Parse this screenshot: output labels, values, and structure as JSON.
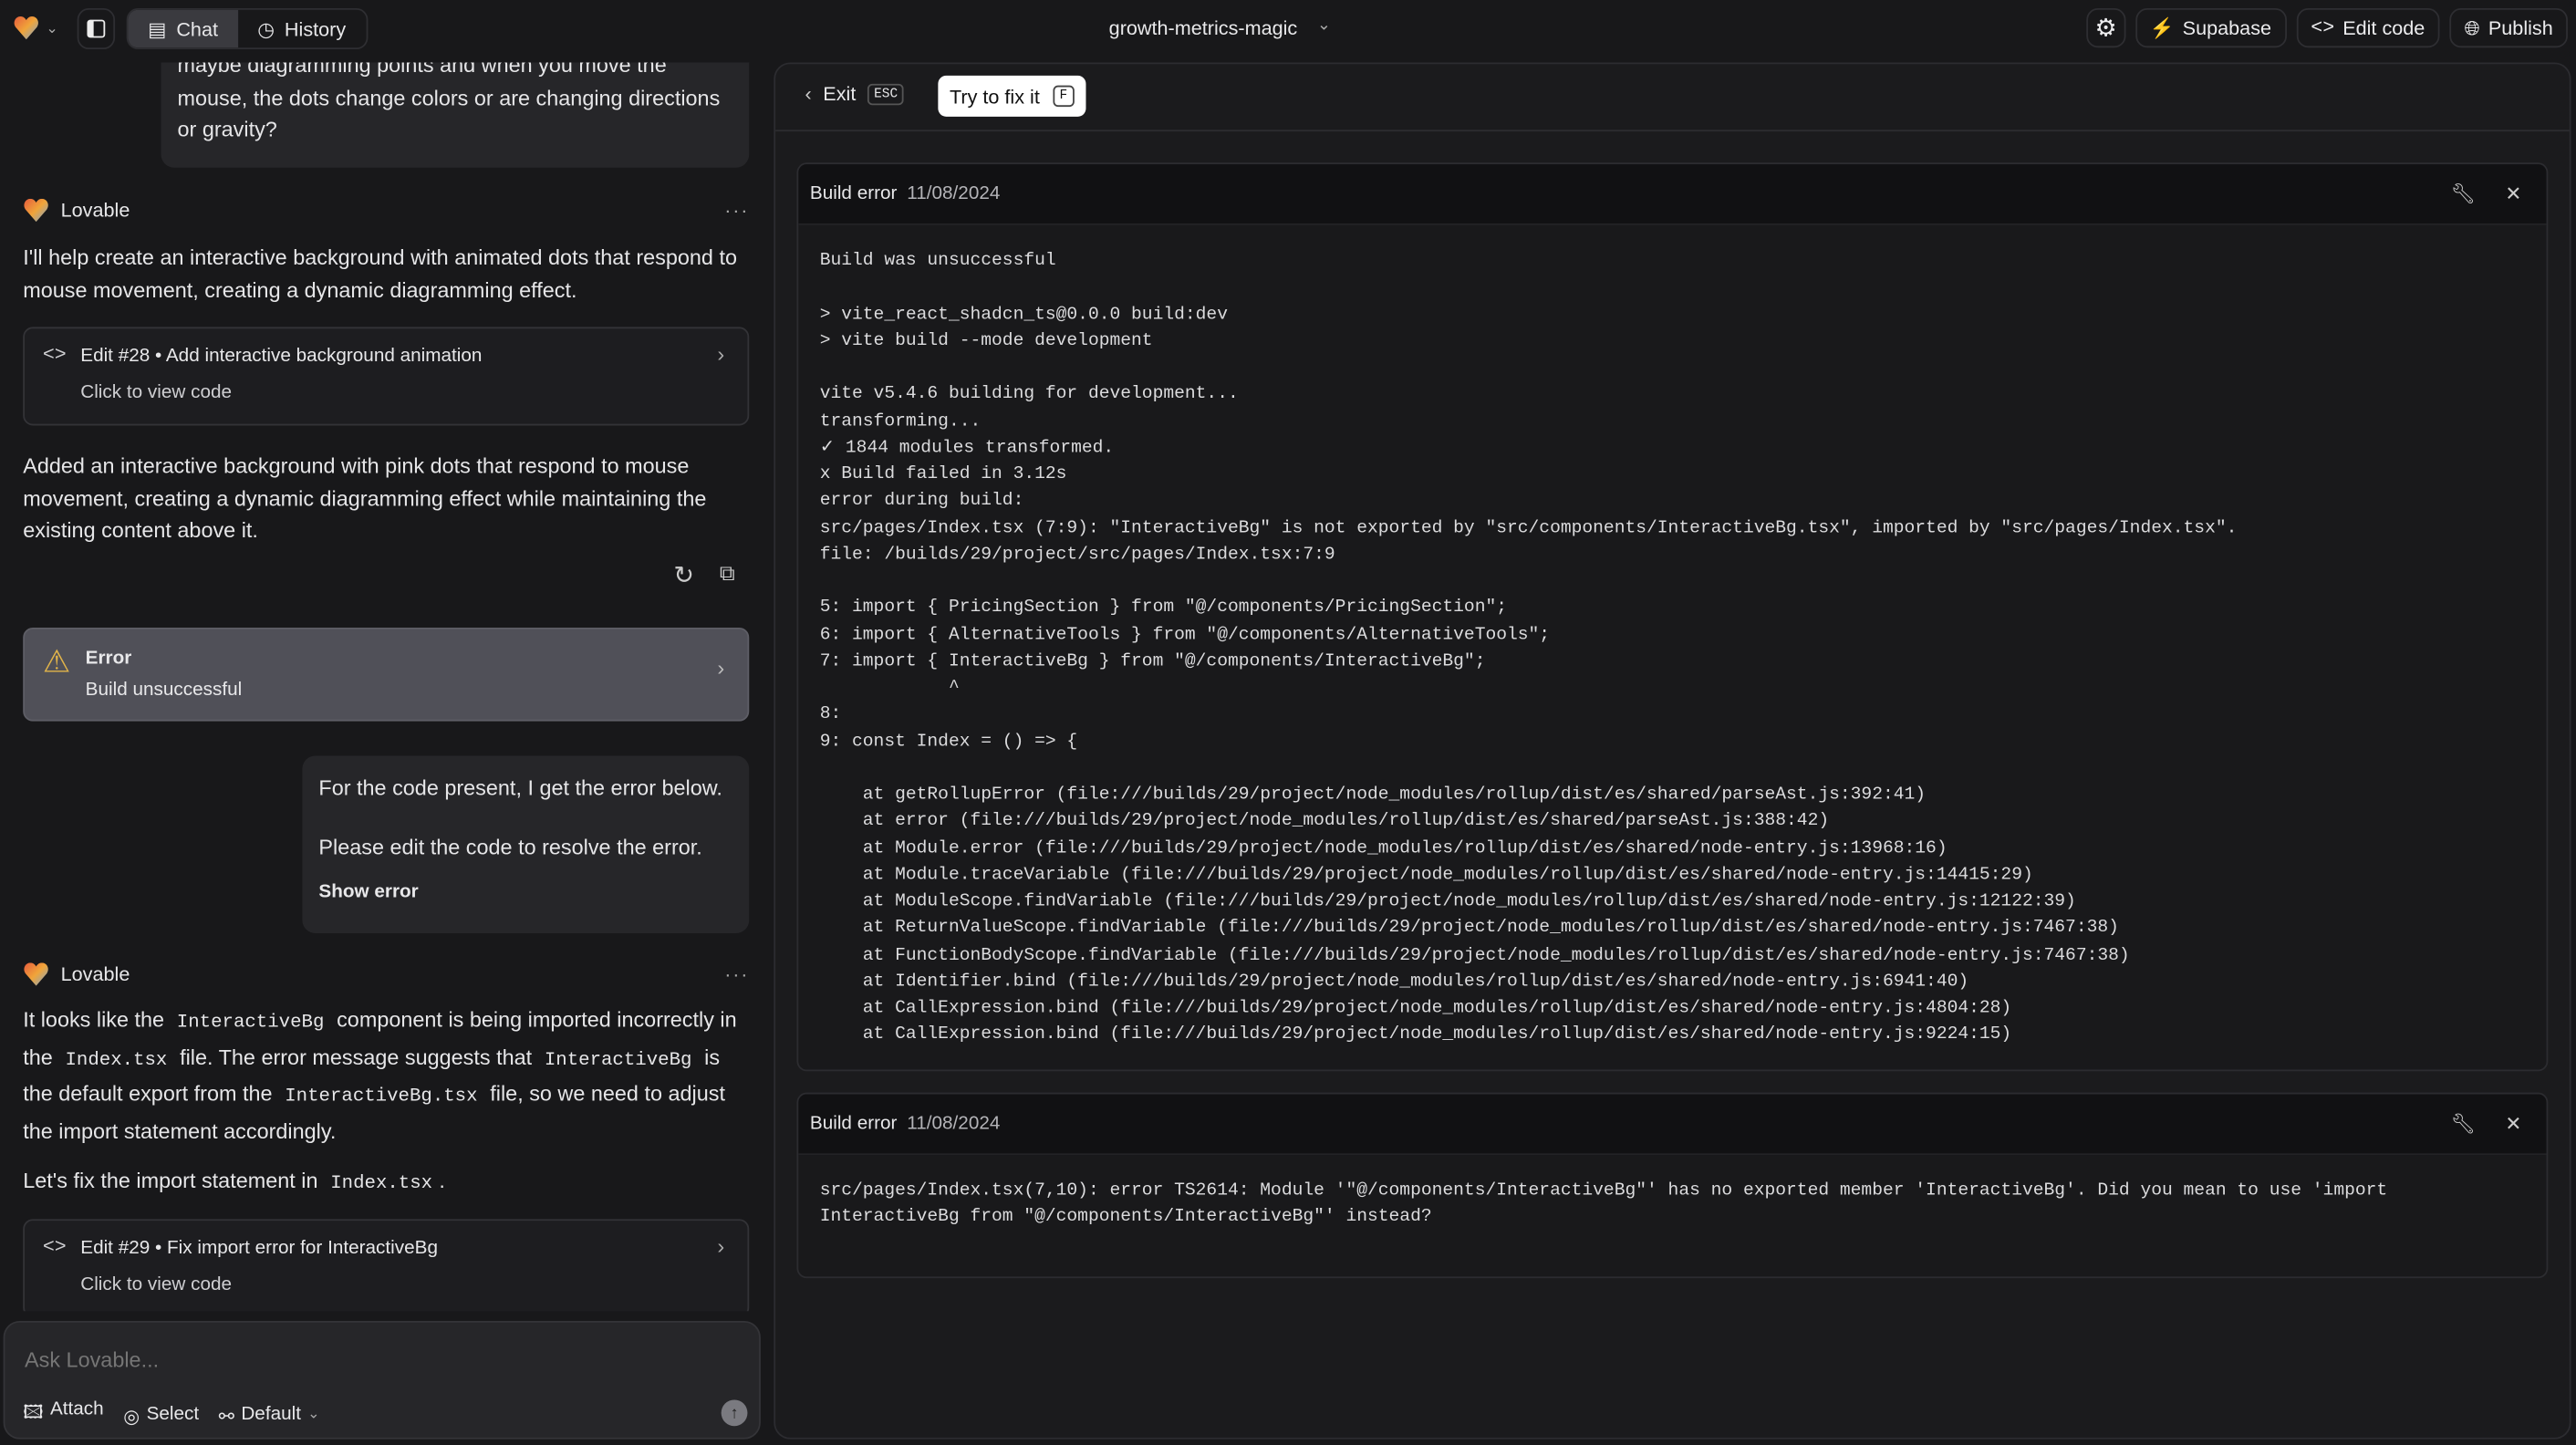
{
  "topbar": {
    "project_name": "growth-metrics-magic",
    "tabs": [
      {
        "label": "Chat",
        "active": true
      },
      {
        "label": "History"
      }
    ],
    "supabase": "Supabase",
    "edit_code": "Edit code",
    "publish": "Publish"
  },
  "chat": {
    "user_msg_1": "maybe diagramming points and when you move the mouse, the dots change colors or are changing directions or gravity?",
    "assistant_name": "Lovable",
    "reply_1": "I'll help create an interactive background with animated dots that respond to mouse movement, creating a dynamic diagramming effect.",
    "edit_1": {
      "title": "Edit #28 • Add interactive background animation",
      "subtitle": "Click to view code"
    },
    "reply_1b": "Added an interactive background with pink dots that respond to mouse movement, creating a dynamic diagramming effect while maintaining the existing content above it.",
    "error_card": {
      "title": "Error",
      "subtitle": "Build unsuccessful",
      "color": "#e0b34a"
    },
    "user_msg_2": {
      "line1": "For the code present, I get the error below.",
      "line2": "Please edit the code to resolve the error.",
      "show_error": "Show error"
    },
    "reply_2": [
      "It looks like the ",
      "InteractiveBg",
      " component is being imported incorrectly in the ",
      "Index.tsx",
      " file. The error message suggests that ",
      "InteractiveBg",
      " is the default export from the ",
      "InteractiveBg.tsx",
      " file, so we need to adjust the import statement accordingly."
    ],
    "reply_2b": [
      "Let's fix the import statement in ",
      "Index.tsx",
      "."
    ],
    "edit_2": {
      "title": "Edit #29 • Fix import error for InteractiveBg",
      "subtitle": "Click to view code"
    },
    "input": {
      "placeholder": "Ask Lovable...",
      "attach": "Attach",
      "select": "Select",
      "mode": "Default"
    }
  },
  "panel": {
    "exit": "Exit",
    "exit_key": "ESC",
    "try_fix": "Try to fix it",
    "try_fix_key": "F",
    "errors": [
      {
        "title": "Build error",
        "date": "11/08/2024",
        "log": "Build was unsuccessful\n\n> vite_react_shadcn_ts@0.0.0 build:dev\n> vite build --mode development\n\nvite v5.4.6 building for development...\ntransforming...\n✓ 1844 modules transformed.\nx Build failed in 3.12s\nerror during build:\nsrc/pages/Index.tsx (7:9): \"InteractiveBg\" is not exported by \"src/components/InteractiveBg.tsx\", imported by \"src/pages/Index.tsx\".\nfile: /builds/29/project/src/pages/Index.tsx:7:9\n\n5: import { PricingSection } from \"@/components/PricingSection\";\n6: import { AlternativeTools } from \"@/components/AlternativeTools\";\n7: import { InteractiveBg } from \"@/components/InteractiveBg\";\n            ^\n8:\n9: const Index = () => {\n\n    at getRollupError (file:///builds/29/project/node_modules/rollup/dist/es/shared/parseAst.js:392:41)\n    at error (file:///builds/29/project/node_modules/rollup/dist/es/shared/parseAst.js:388:42)\n    at Module.error (file:///builds/29/project/node_modules/rollup/dist/es/shared/node-entry.js:13968:16)\n    at Module.traceVariable (file:///builds/29/project/node_modules/rollup/dist/es/shared/node-entry.js:14415:29)\n    at ModuleScope.findVariable (file:///builds/29/project/node_modules/rollup/dist/es/shared/node-entry.js:12122:39)\n    at ReturnValueScope.findVariable (file:///builds/29/project/node_modules/rollup/dist/es/shared/node-entry.js:7467:38)\n    at FunctionBodyScope.findVariable (file:///builds/29/project/node_modules/rollup/dist/es/shared/node-entry.js:7467:38)\n    at Identifier.bind (file:///builds/29/project/node_modules/rollup/dist/es/shared/node-entry.js:6941:40)\n    at CallExpression.bind (file:///builds/29/project/node_modules/rollup/dist/es/shared/node-entry.js:4804:28)\n    at CallExpression.bind (file:///builds/29/project/node_modules/rollup/dist/es/shared/node-entry.js:9224:15)"
      },
      {
        "title": "Build error",
        "date": "11/08/2024",
        "log": "src/pages/Index.tsx(7,10): error TS2614: Module '\"@/components/InteractiveBg\"' has no exported member 'InteractiveBg'. Did you mean to use 'import\nInteractiveBg from \"@/components/InteractiveBg\"' instead?"
      }
    ]
  }
}
